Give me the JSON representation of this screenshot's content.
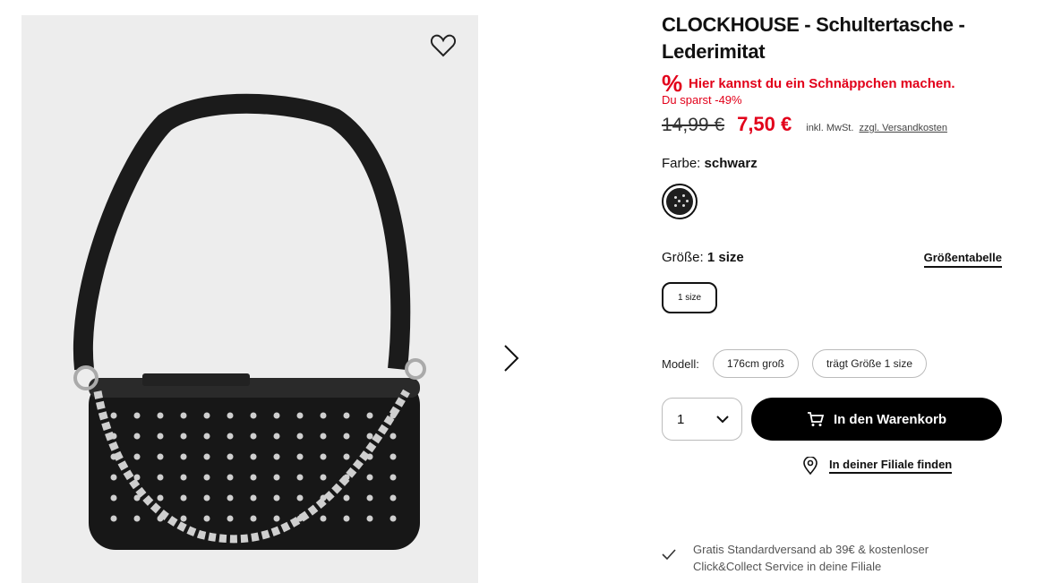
{
  "product": {
    "title": "CLOCKHOUSE - Schultertasche - Lederimitat",
    "deal_text": "Hier kannst du ein Schnäppchen machen.",
    "deal_icon": "percent-icon",
    "savings": "Du sparst -49%",
    "old_price": "14,99 €",
    "new_price": "7,50 €",
    "tax_note": "inkl. MwSt.",
    "shipping_link": "zzgl. Versandkosten"
  },
  "color": {
    "label": "Farbe:",
    "value": "schwarz"
  },
  "size": {
    "label": "Größe:",
    "value": "1 size",
    "table_link": "Größentabelle",
    "options": [
      "1 size"
    ]
  },
  "model": {
    "label": "Modell:",
    "height": "176cm groß",
    "wears": "trägt Größe 1 size"
  },
  "purchase": {
    "quantity": "1",
    "cart_button": "In den Warenkorb",
    "store_link": "In deiner Filiale finden"
  },
  "shipping": {
    "text": "Gratis Standardversand ab 39€ & kostenloser Click&Collect Service in deine Filiale"
  },
  "colors": {
    "accent_red": "#e2001a",
    "button_black": "#000000",
    "gallery_bg": "#ededed"
  }
}
